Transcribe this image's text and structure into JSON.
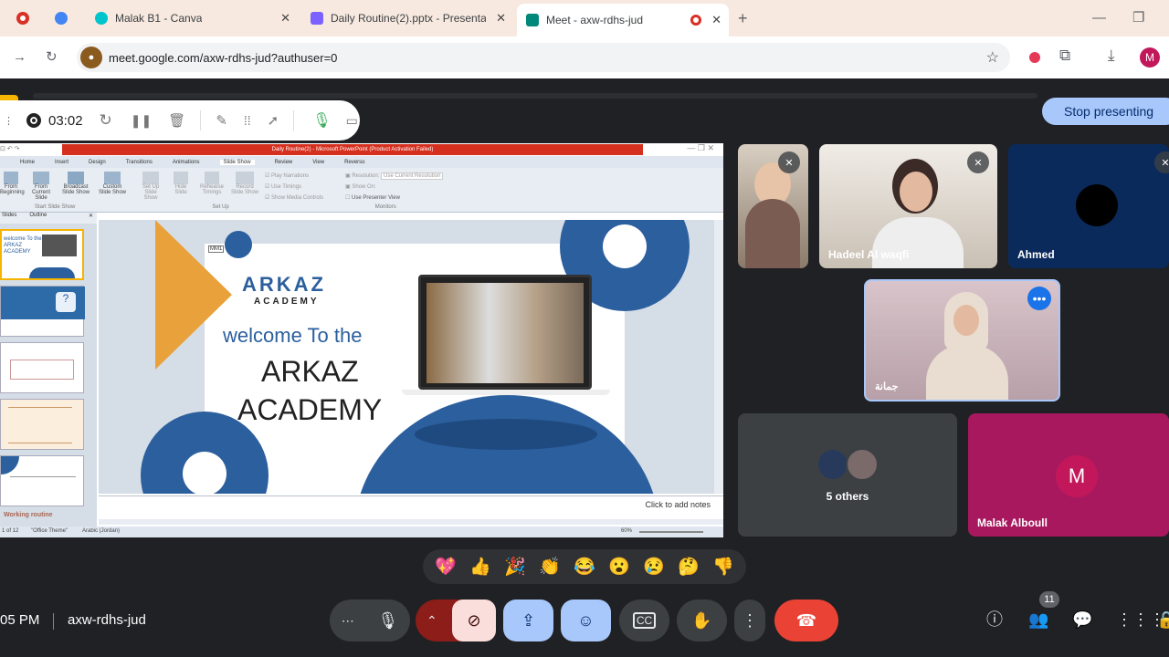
{
  "browser": {
    "tabs": [
      {
        "label": "",
        "color": "#d93025"
      },
      {
        "label": "",
        "color": "#4285f4"
      },
      {
        "label": "Malak B1 - Canva",
        "color": "#00c4cc"
      },
      {
        "label": "Daily Routine(2).pptx - Presenta",
        "color": "#7b61ff"
      },
      {
        "label": "Meet - axw-rdhs-jud",
        "color": "#00897b"
      }
    ],
    "new_tab_icon": "plus-icon",
    "url": "meet.google.com/axw-rdhs-jud?authuser=0",
    "profile_initial": "M"
  },
  "meet": {
    "stop_presenting_label": "Stop presenting",
    "recording": {
      "time": "03:02"
    },
    "participants": [
      {
        "name": ""
      },
      {
        "name": "Hadeel Al waqfi"
      },
      {
        "name": "Ahmed"
      },
      {
        "name": "جمانة"
      },
      {
        "name": "5 others"
      },
      {
        "name": "Malak Alboull",
        "initial": "M"
      }
    ],
    "reactions": [
      "💖",
      "👍",
      "🎉",
      "👏",
      "😂",
      "😮",
      "😢",
      "🤔",
      "👎"
    ],
    "time_text": "05 PM",
    "meeting_code": "axw-rdhs-jud",
    "people_count": "11"
  },
  "ppt": {
    "title": "Daily Routine(2) - Microsoft PowerPoint (Product Activation Failed)",
    "ribbon_tabs": [
      "Home",
      "Insert",
      "Design",
      "Transitions",
      "Animations",
      "Slide Show",
      "Review",
      "View",
      "Reverso"
    ],
    "ribbon_buttons": [
      "From Beginning",
      "From Current Slide",
      "Broadcast Slide Show",
      "Custom Slide Show",
      "Set Up Slide Show",
      "Hide Slide",
      "Rehearse Timings",
      "Record Slide Show"
    ],
    "ribbon_groups": [
      "Start Slide Show",
      "Set Up",
      "Monitors"
    ],
    "checkboxes": [
      "Play Narrations",
      "Use Timings",
      "Show Media Controls"
    ],
    "resolution_label": "Resolution:",
    "resolution_value": "Use Current Resolution",
    "show_on_label": "Show On:",
    "presenter_view": "Use Presenter View",
    "panel_tabs": [
      "Slides",
      "Outline"
    ],
    "slide": {
      "logo_main": "ARKAZ",
      "logo_sub": "ACADEMY",
      "line1": "welcome To the",
      "line2": "ARKAZ",
      "line3": "ACADEMY",
      "tag": "MM1"
    },
    "notes_placeholder": "Click to add notes",
    "status_slide": "1 of 12",
    "status_theme": "\"Office Theme\"",
    "status_lang": "Arabic (Jordan)",
    "zoom": "60%",
    "thumb_last": "Working routine"
  },
  "colors": {
    "accent_blue": "#2c5f9e",
    "orange": "#e9a23b",
    "meet_bg": "#202124",
    "end_call": "#ea4335"
  }
}
